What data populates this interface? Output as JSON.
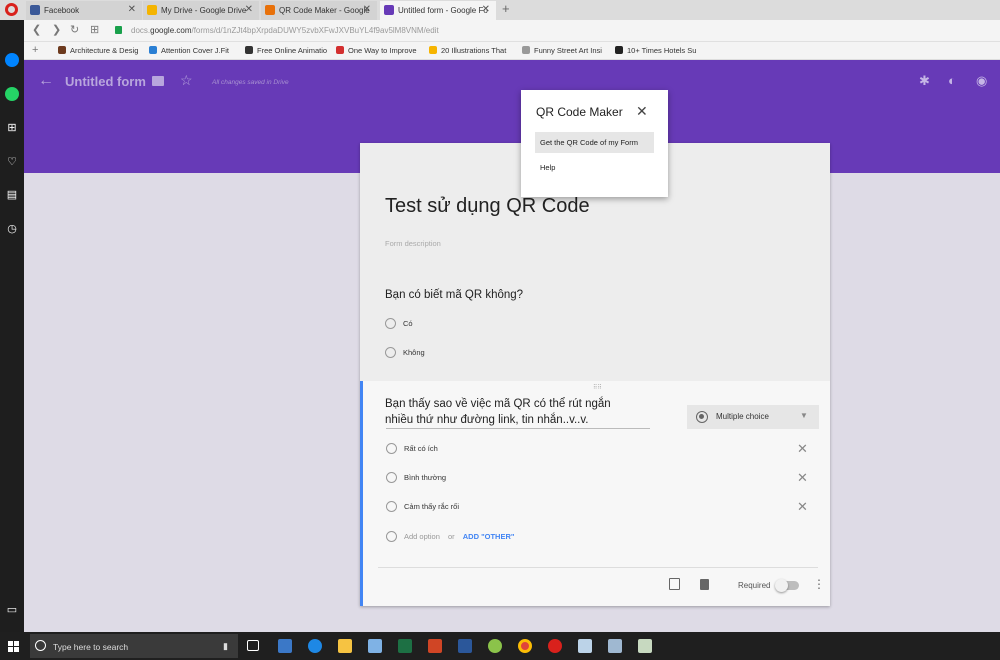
{
  "browser": {
    "tabs": [
      {
        "label": "Facebook",
        "fav_color": "#3b5998"
      },
      {
        "label": "My Drive - Google Drive",
        "fav_color": "#f4b400"
      },
      {
        "label": "QR Code Maker - Google",
        "fav_color": "#e8710a"
      },
      {
        "label": "Untitled form - Google Fo",
        "fav_color": "#673ab7"
      }
    ],
    "url_prefix": "docs.",
    "url_domain": "google.com",
    "url_path": "/forms/d/1nZJt4bpXrpdaDUWY5zvbXFwJXVBuYL4f9av5lM8VNM/edit",
    "bookmarks": [
      {
        "label": "Architecture & Desig",
        "color": "#6d3a1e"
      },
      {
        "label": "Attention Cover J.Fit",
        "color": "#2a7fd4"
      },
      {
        "label": "Free Online Animatio",
        "color": "#333333"
      },
      {
        "label": "One Way to Improve",
        "color": "#d32f2f"
      },
      {
        "label": "20 Illustrations That",
        "color": "#f6b400"
      },
      {
        "label": "Funny Street Art Insi",
        "color": "#999999"
      },
      {
        "label": "10+ Times Hotels Su",
        "color": "#222222"
      }
    ]
  },
  "form": {
    "header_title": "Untitled form",
    "saved_status": "All changes saved in Drive",
    "title": "Test sử dụng QR Code",
    "description_placeholder": "Form description",
    "question1": {
      "text": "Bạn có biết mã QR không?",
      "options": [
        "Có",
        "Không"
      ]
    },
    "question2": {
      "text_line1": "Bạn thấy sao về việc mã QR có thể rút ngắn",
      "text_line2": "nhiều thứ như đường link, tin nhắn..v..v.",
      "type_label": "Multiple choice",
      "options": [
        "Rất có ích",
        "Bình thường",
        "Cảm thấy rắc rối"
      ],
      "add_option": "Add option",
      "or": "or",
      "add_other": "ADD \"OTHER\"",
      "required_label": "Required"
    }
  },
  "popup": {
    "title": "QR Code Maker",
    "get_qr_label": "Get the QR Code of my Form",
    "help_label": "Help"
  },
  "taskbar": {
    "search_placeholder": "Type here to search"
  }
}
